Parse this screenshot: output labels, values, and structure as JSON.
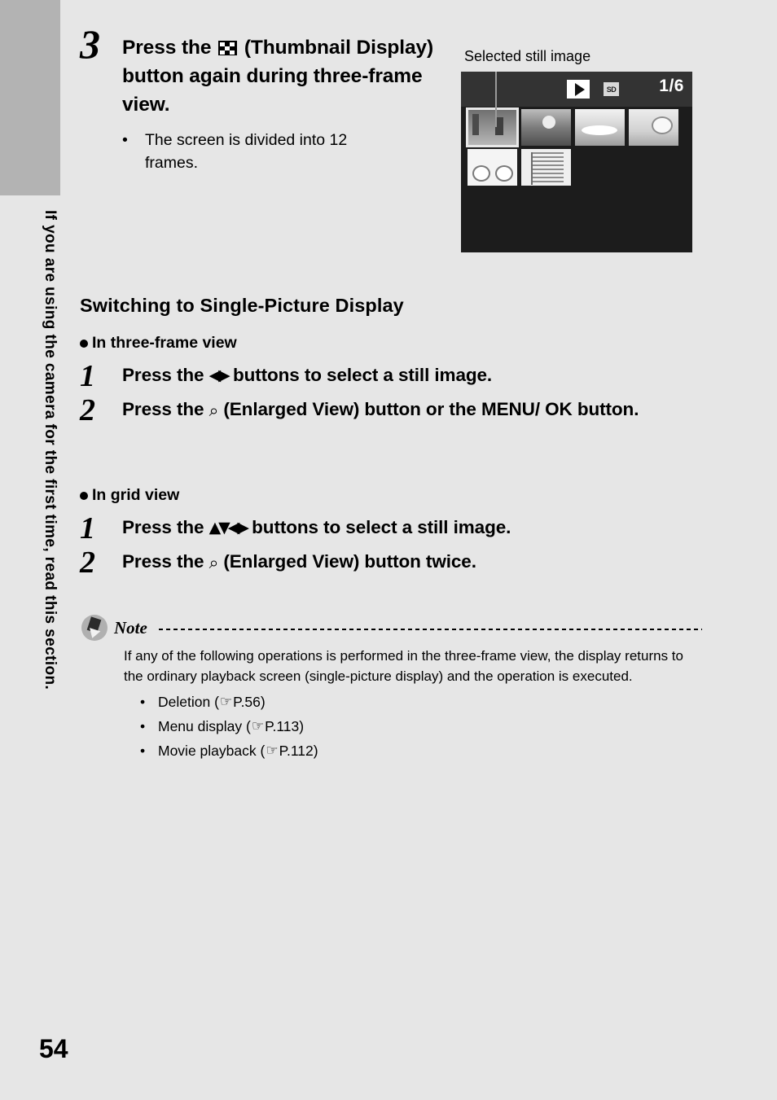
{
  "page": {
    "folio": "54",
    "side_tab_text": "If you are using the camera for the first time, read this section."
  },
  "step3": {
    "number": "3",
    "title_part1": "Press the ",
    "icon_name": "thumbnail-display-icon",
    "title_part2": " (Thumbnail Display) button again during three-frame view.",
    "bullet_dot": "•",
    "bullet_text": "The screen is divided into 12 frames."
  },
  "figure": {
    "caption": "Selected still image",
    "lcd": {
      "play_icon": "play-icon",
      "sd_icon_label": "SD",
      "counter": "1/6",
      "thumbnails": [
        {
          "id": "thumb-1",
          "selected": true,
          "style": "th-a"
        },
        {
          "id": "thumb-2",
          "selected": false,
          "style": "th-b"
        },
        {
          "id": "thumb-3",
          "selected": false,
          "style": "th-c"
        },
        {
          "id": "thumb-4",
          "selected": false,
          "style": "th-d"
        },
        {
          "id": "thumb-5",
          "selected": false,
          "style": "th-e"
        },
        {
          "id": "thumb-6",
          "selected": false,
          "style": "th-f"
        }
      ]
    }
  },
  "section": {
    "heading": "Switching to Single-Picture Display"
  },
  "group_three_frame": {
    "lead": "In three-frame view",
    "steps": [
      {
        "number": "1",
        "text_before": "Press the ",
        "glyphs": "◀▶",
        "text_after": " buttons to select a still image."
      },
      {
        "number": "2",
        "text_before": "Press the ",
        "glyphs": "⌕",
        "text_after": " (Enlarged View) button or the MENU/ OK button."
      }
    ]
  },
  "group_grid": {
    "lead": "In grid view",
    "steps": [
      {
        "number": "1",
        "text_before": "Press the ",
        "glyphs": "▲▼◀▶",
        "text_after": " buttons to select a still image."
      },
      {
        "number": "2",
        "text_before": "Press the ",
        "glyphs": "⌕",
        "text_after": " (Enlarged View) button twice."
      }
    ]
  },
  "note": {
    "title": "Note",
    "body": "If any of the following operations is performed in the three-frame view, the display returns to the ordinary playback screen (single-picture display) and the operation is executed.",
    "items": [
      {
        "dot": "•",
        "label": "Deletion (",
        "hand": "☞",
        "ref": "P.56)"
      },
      {
        "dot": "•",
        "label": "Menu display (",
        "hand": "☞",
        "ref": "P.113)"
      },
      {
        "dot": "•",
        "label": "Movie playback (",
        "hand": "☞",
        "ref": "P.112)"
      }
    ]
  },
  "colors": {
    "page_bg": "#e6e6e6",
    "tab_gray": "#b3b3b3",
    "lcd_bg": "#1c1c1c",
    "lcd_top": "#333333",
    "text": "#000000"
  }
}
